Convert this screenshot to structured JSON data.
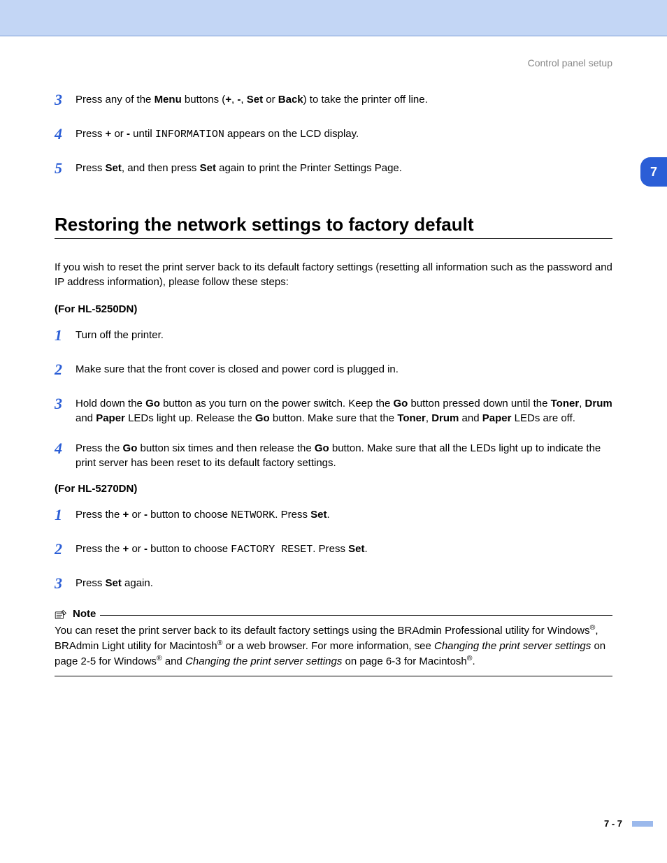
{
  "header": {
    "right": "Control panel setup"
  },
  "chapter_tab": "7",
  "top_steps": [
    {
      "n": "3",
      "segs": [
        {
          "t": "Press any of the "
        },
        {
          "t": "Menu",
          "b": true
        },
        {
          "t": " buttons ("
        },
        {
          "t": "+",
          "b": true
        },
        {
          "t": ", "
        },
        {
          "t": "-",
          "b": true
        },
        {
          "t": ", "
        },
        {
          "t": "Set",
          "b": true
        },
        {
          "t": " or "
        },
        {
          "t": "Back",
          "b": true
        },
        {
          "t": ") to take the printer off line."
        }
      ]
    },
    {
      "n": "4",
      "segs": [
        {
          "t": "Press "
        },
        {
          "t": "+",
          "b": true
        },
        {
          "t": " or "
        },
        {
          "t": "-",
          "b": true
        },
        {
          "t": " until "
        },
        {
          "t": "INFORMATION",
          "m": true
        },
        {
          "t": " appears on the LCD display."
        }
      ]
    },
    {
      "n": "5",
      "segs": [
        {
          "t": "Press "
        },
        {
          "t": "Set",
          "b": true
        },
        {
          "t": ", and then press "
        },
        {
          "t": "Set",
          "b": true
        },
        {
          "t": " again to print the Printer Settings Page."
        }
      ]
    }
  ],
  "h1": "Restoring the network settings to factory default",
  "intro": "If you wish to reset the print server back to its default factory settings (resetting all information such as the password and IP address information), please follow these steps:",
  "sub_a": "(For HL-5250DN)",
  "steps_a": [
    {
      "n": "1",
      "segs": [
        {
          "t": "Turn off the printer."
        }
      ]
    },
    {
      "n": "2",
      "segs": [
        {
          "t": "Make sure that the front cover is closed and power cord is plugged in."
        }
      ]
    },
    {
      "n": "3",
      "segs": [
        {
          "t": "Hold down the "
        },
        {
          "t": "Go",
          "b": true
        },
        {
          "t": " button as you turn on the power switch. Keep the "
        },
        {
          "t": "Go",
          "b": true
        },
        {
          "t": " button pressed down until the "
        },
        {
          "t": "Toner",
          "b": true
        },
        {
          "t": ", "
        },
        {
          "t": "Drum",
          "b": true
        },
        {
          "t": " and "
        },
        {
          "t": "Paper",
          "b": true
        },
        {
          "t": " LEDs light up. Release the "
        },
        {
          "t": "Go",
          "b": true
        },
        {
          "t": " button. Make sure that the "
        },
        {
          "t": "Toner",
          "b": true
        },
        {
          "t": ", "
        },
        {
          "t": "Drum",
          "b": true
        },
        {
          "t": " and "
        },
        {
          "t": "Paper",
          "b": true
        },
        {
          "t": " LEDs are off."
        }
      ]
    },
    {
      "n": "4",
      "segs": [
        {
          "t": "Press the "
        },
        {
          "t": "Go",
          "b": true
        },
        {
          "t": " button six times and then release the "
        },
        {
          "t": "Go",
          "b": true
        },
        {
          "t": " button. Make sure that all the LEDs light up to indicate the print server has been reset to its default factory settings."
        }
      ]
    }
  ],
  "sub_b": "(For HL-5270DN)",
  "steps_b": [
    {
      "n": "1",
      "segs": [
        {
          "t": "Press the "
        },
        {
          "t": "+",
          "b": true
        },
        {
          "t": " or "
        },
        {
          "t": "-",
          "b": true
        },
        {
          "t": " button to choose "
        },
        {
          "t": "NETWORK",
          "m": true
        },
        {
          "t": ". Press "
        },
        {
          "t": "Set",
          "b": true
        },
        {
          "t": "."
        }
      ]
    },
    {
      "n": "2",
      "segs": [
        {
          "t": "Press the "
        },
        {
          "t": "+",
          "b": true
        },
        {
          "t": " or "
        },
        {
          "t": "-",
          "b": true
        },
        {
          "t": " button to choose "
        },
        {
          "t": "FACTORY RESET",
          "m": true
        },
        {
          "t": ". Press "
        },
        {
          "t": "Set",
          "b": true
        },
        {
          "t": "."
        }
      ]
    },
    {
      "n": "3",
      "segs": [
        {
          "t": "Press "
        },
        {
          "t": "Set",
          "b": true
        },
        {
          "t": " again."
        }
      ]
    }
  ],
  "note": {
    "label": "Note",
    "segs": [
      {
        "t": "You can reset the print server back to its default factory settings using the BRAdmin Professional utility for Windows"
      },
      {
        "t": "®",
        "sup": true
      },
      {
        "t": ", BRAdmin Light utility for Macintosh"
      },
      {
        "t": "®",
        "sup": true
      },
      {
        "t": " or a web browser. For more information, see "
      },
      {
        "t": "Changing the print server settings",
        "i": true
      },
      {
        "t": " on page 2-5 for Windows"
      },
      {
        "t": "®",
        "sup": true
      },
      {
        "t": " and "
      },
      {
        "t": "Changing the print server settings",
        "i": true
      },
      {
        "t": " on page 6-3 for Macintosh"
      },
      {
        "t": "®",
        "sup": true
      },
      {
        "t": "."
      }
    ]
  },
  "footer": "7 - 7"
}
